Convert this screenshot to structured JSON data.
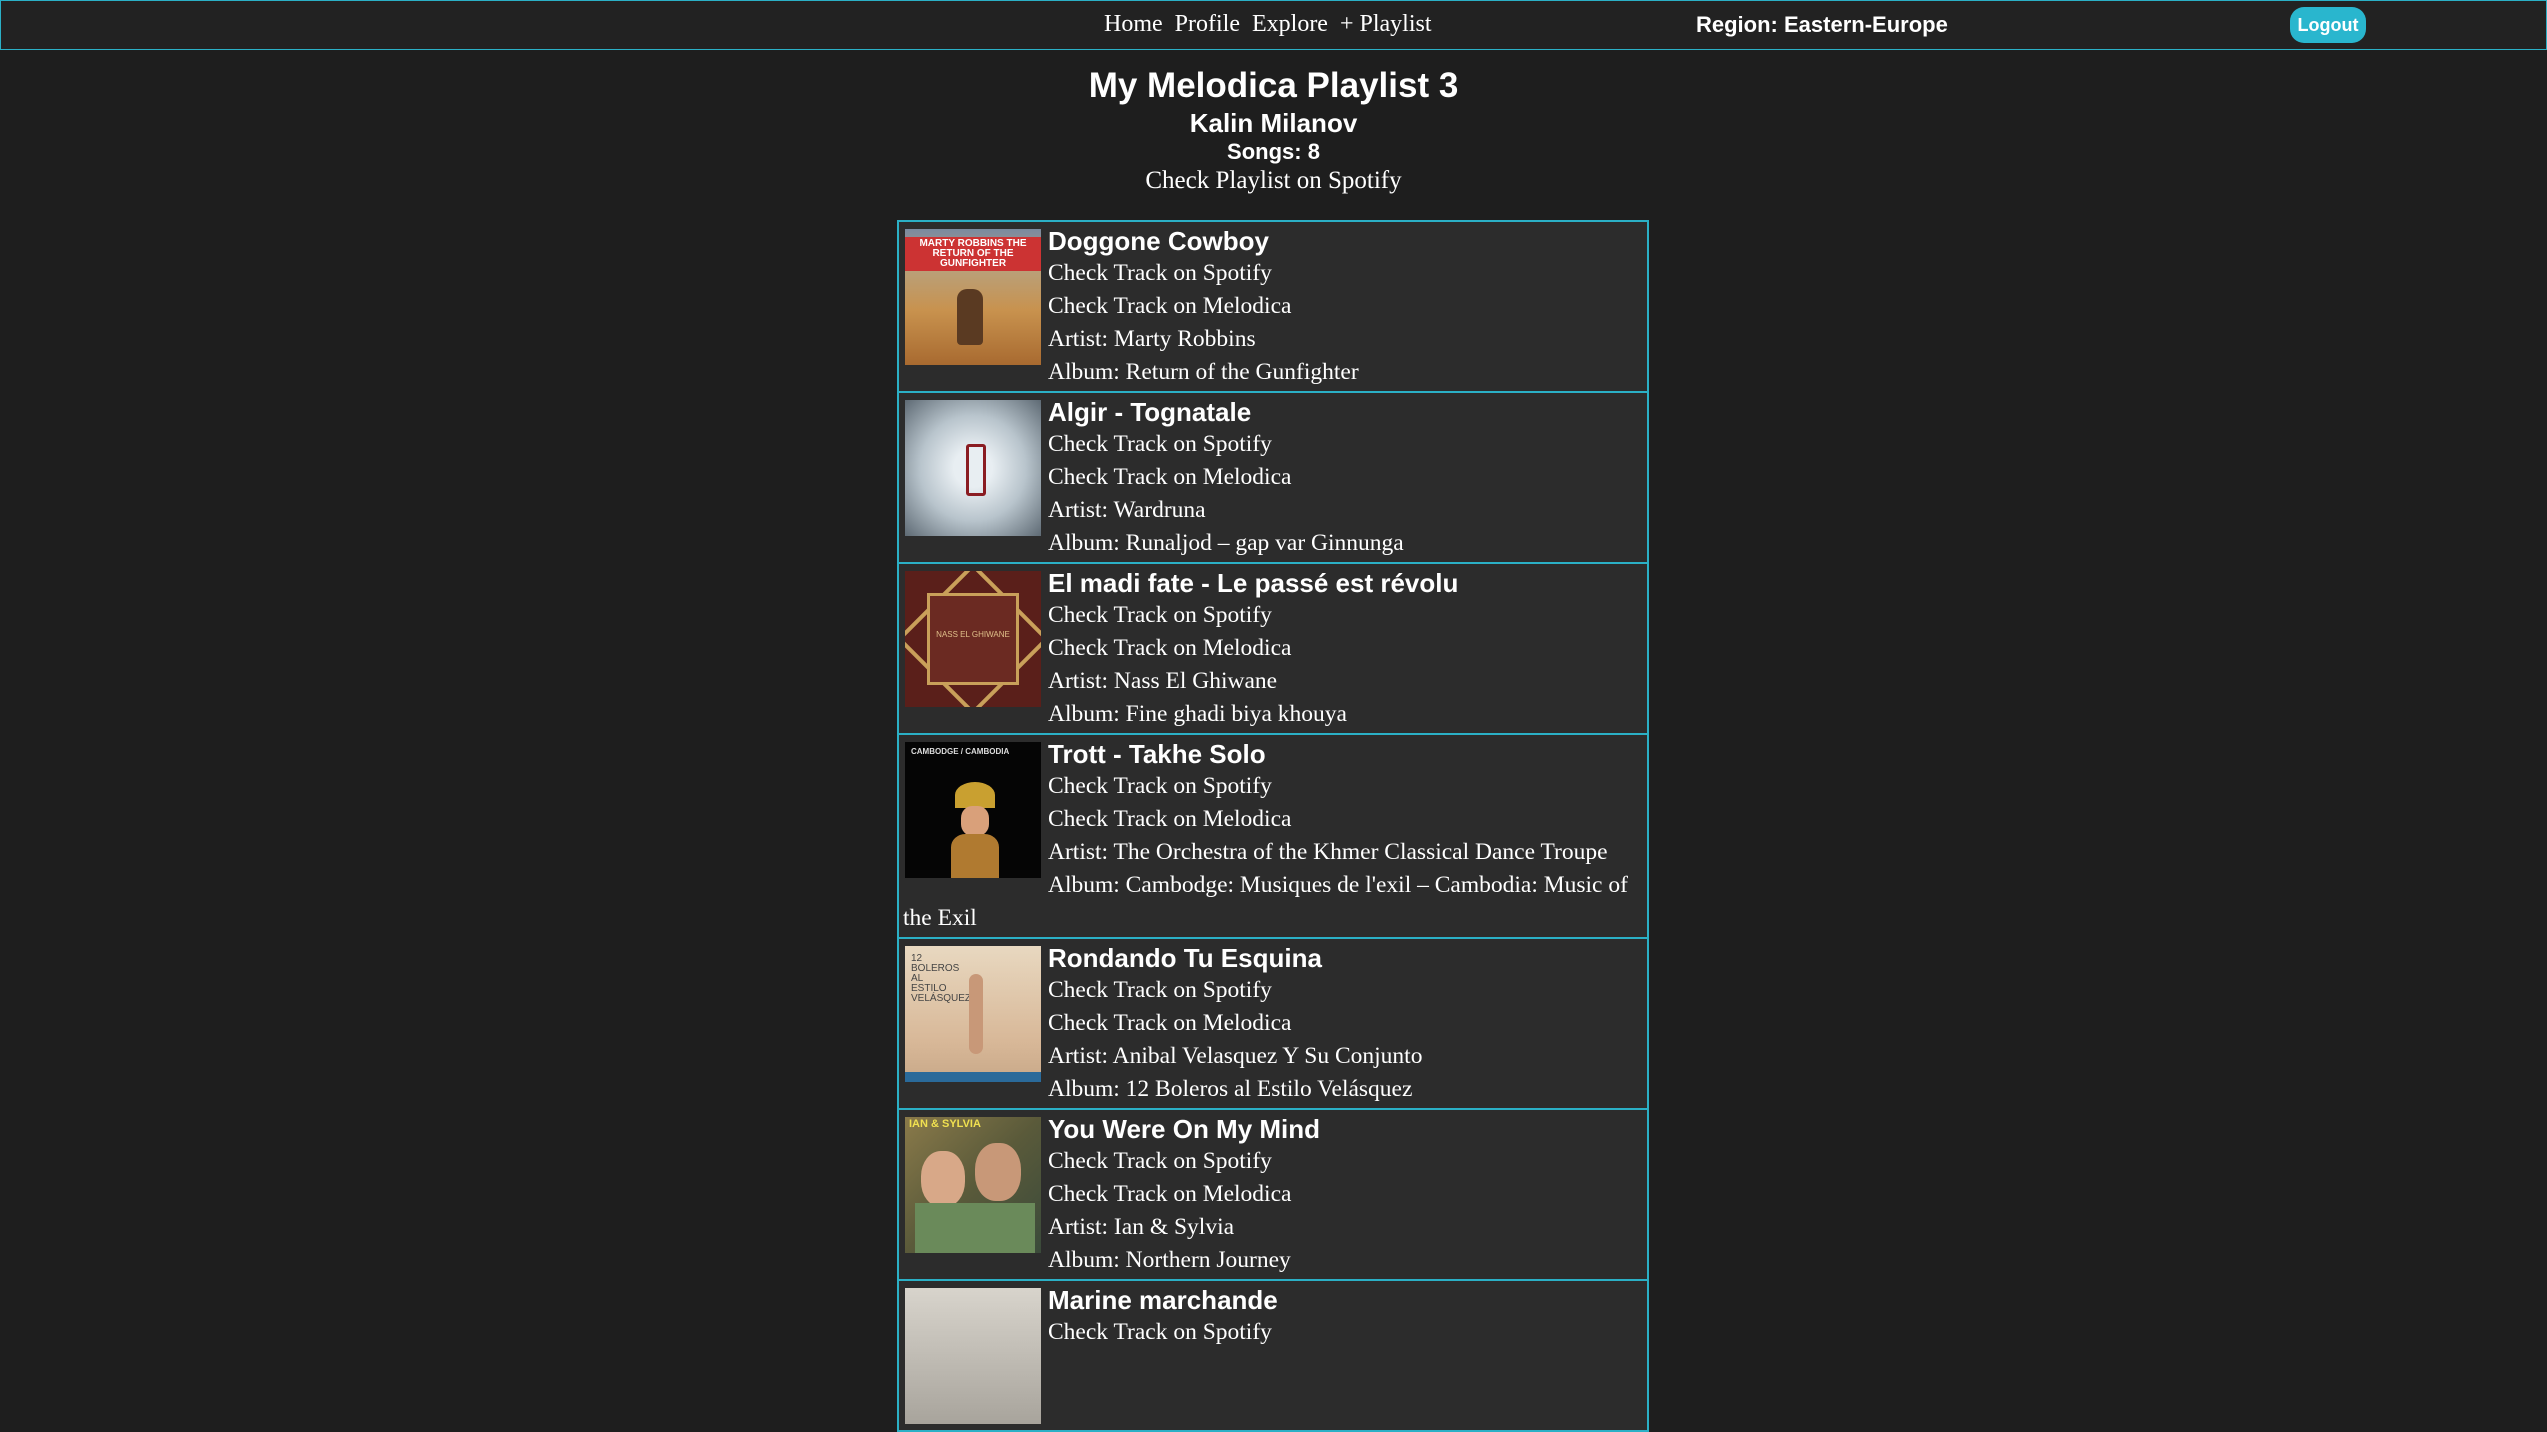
{
  "nav": {
    "home": "Home",
    "profile": "Profile",
    "explore": "Explore",
    "add_playlist": "+ Playlist",
    "region": "Region: Eastern-Europe",
    "logout": "Logout"
  },
  "playlist": {
    "title": "My Melodica Playlist 3",
    "owner": "Kalin Milanov",
    "songs": "Songs: 8",
    "spotify_link": "Check Playlist on Spotify"
  },
  "tracks": [
    {
      "name": "Doggone Cowboy",
      "spotify": "Check Track on Spotify",
      "melodica": "Check Track on Melodica",
      "artist": "Artist: Marty Robbins",
      "album": "Album: Return of the Gunfighter",
      "cover_text": "MARTY ROBBINS THE RETURN OF THE GUNFIGHTER"
    },
    {
      "name": "Algir - Tognatale",
      "spotify": "Check Track on Spotify",
      "melodica": "Check Track on Melodica",
      "artist": "Artist: Wardruna",
      "album": "Album: Runaljod – gap var Ginnunga"
    },
    {
      "name": "El madi fate - Le passé est révolu",
      "spotify": "Check Track on Spotify",
      "melodica": "Check Track on Melodica",
      "artist": "Artist: Nass El Ghiwane",
      "album": "Album: Fine ghadi biya khouya",
      "cover_text": "NASS EL GHIWANE"
    },
    {
      "name": "Trott - Takhe Solo",
      "spotify": "Check Track on Spotify",
      "melodica": "Check Track on Melodica",
      "artist": "Artist: The Orchestra of the Khmer Classical Dance Troupe",
      "album": "Album: Cambodge: Musiques de l'exil – Cambodia: Music of the Exil",
      "cover_text": "CAMBODGE / CAMBODIA"
    },
    {
      "name": "Rondando Tu Esquina",
      "spotify": "Check Track on Spotify",
      "melodica": "Check Track on Melodica",
      "artist": "Artist: Anibal Velasquez Y Su Conjunto",
      "album": "Album: 12 Boleros al Estilo Velásquez",
      "cover_text": "12 BOLEROS AL ESTILO VELÁSQUEZ"
    },
    {
      "name": "You Were On My Mind",
      "spotify": "Check Track on Spotify",
      "melodica": "Check Track on Melodica",
      "artist": "Artist: Ian & Sylvia",
      "album": "Album: Northern Journey",
      "cover_text": "IAN & SYLVIA"
    },
    {
      "name": "Marine marchande",
      "spotify": "Check Track on Spotify"
    }
  ]
}
